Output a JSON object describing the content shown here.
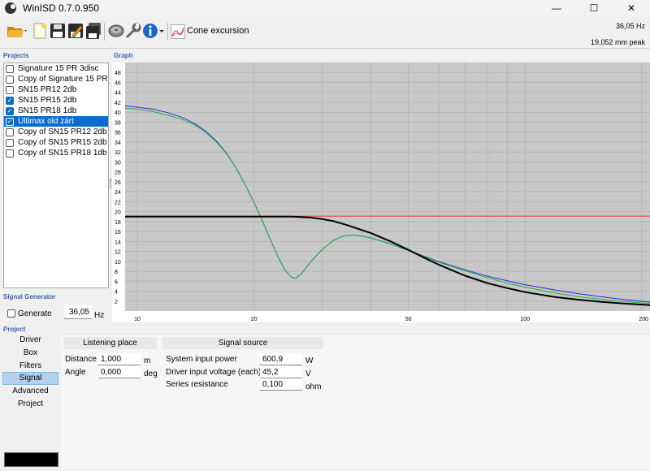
{
  "window": {
    "title": "WinISD 0.7.0.950",
    "minimize": "—",
    "maximize": "☐",
    "close": "✕"
  },
  "toolbar": {
    "icons": [
      "open-folder-icon",
      "new-document-icon",
      "save-icon",
      "save-as-icon",
      "save-all-icon",
      "speaker-icon",
      "wrench-icon",
      "info-icon",
      "cone-excursion-chart-icon"
    ],
    "view_label": "Cone excursion",
    "readout_frequency": "36,05 Hz",
    "readout_excursion": "19,052 mm peak"
  },
  "sections": {
    "projects": "Projects",
    "graph": "Graph",
    "signal_generator": "Signal Generator",
    "project": "Project"
  },
  "projects": [
    {
      "label": "Signature 15 PR 3disc",
      "checked": false,
      "selected": false
    },
    {
      "label": "Copy of Signature 15 PR 5d",
      "checked": false,
      "selected": false
    },
    {
      "label": "SN15 PR12 2db",
      "checked": false,
      "selected": false
    },
    {
      "label": "SN15 PR15 2db",
      "checked": true,
      "selected": false
    },
    {
      "label": "SN15 PR18 1db",
      "checked": true,
      "selected": false
    },
    {
      "label": "Ultimax old zárt",
      "checked": true,
      "selected": true
    },
    {
      "label": "Copy of SN15 PR12 2db",
      "checked": false,
      "selected": false
    },
    {
      "label": "Copy of SN15 PR15 2db",
      "checked": false,
      "selected": false
    },
    {
      "label": "Copy of SN15 PR18 1db",
      "checked": false,
      "selected": false
    }
  ],
  "signal_generator": {
    "generate_label": "Generate",
    "frequency_value": "36,05",
    "unit": "Hz"
  },
  "project_nav": {
    "items": [
      "Driver",
      "Box",
      "Filters",
      "Signal",
      "Advanced",
      "Project"
    ],
    "active": "Signal"
  },
  "listening_place": {
    "header": "Listening place",
    "distance_label": "Distance",
    "distance_value": "1,000",
    "distance_unit": "m",
    "angle_label": "Angle",
    "angle_value": "0,000",
    "angle_unit": "deg"
  },
  "signal_source": {
    "header": "Signal source",
    "power_label": "System input power",
    "power_value": "600,9",
    "power_unit": "W",
    "voltage_label": "Driver input voltage (each)",
    "voltage_value": "45,2",
    "voltage_unit": "V",
    "resistance_label": "Series resistance",
    "resistance_value": "0,100",
    "resistance_unit": "ohm"
  },
  "colors": {
    "selection": "#0a6ccf",
    "series_black": "#000000",
    "series_red": "#e03030",
    "series_blue": "#2b2bdc",
    "series_green": "#20b040",
    "plot_bg": "#c8c8c8"
  },
  "chart_data": {
    "type": "line",
    "x_scale": "log",
    "xlim": [
      9.3,
      210
    ],
    "ylim": [
      0,
      50
    ],
    "x_ticks": [
      {
        "v": 10,
        "label": "10"
      },
      {
        "v": 20,
        "label": "20"
      },
      {
        "v": 50,
        "label": "50"
      },
      {
        "v": 100,
        "label": "100"
      },
      {
        "v": 200,
        "label": "200"
      }
    ],
    "y_ticks": [
      2,
      4,
      6,
      8,
      10,
      12,
      14,
      16,
      18,
      20,
      22,
      24,
      26,
      28,
      30,
      32,
      34,
      36,
      38,
      40,
      42,
      44,
      46,
      48
    ],
    "grid": true,
    "series": [
      {
        "color": "#2b2bdc",
        "width": 1,
        "points": [
          [
            9.3,
            41.3
          ],
          [
            10,
            41
          ],
          [
            11,
            40.6
          ],
          [
            12,
            39.9
          ],
          [
            13,
            39
          ],
          [
            14,
            37.8
          ],
          [
            15,
            36.2
          ],
          [
            16,
            34.2
          ],
          [
            17,
            31.7
          ],
          [
            18,
            28.7
          ],
          [
            19,
            25.3
          ],
          [
            20,
            21.8
          ],
          [
            21,
            18.2
          ],
          [
            22,
            14.5
          ],
          [
            23,
            11.1
          ],
          [
            24,
            8.3
          ],
          [
            25,
            6.8
          ],
          [
            25.6,
            6.6
          ],
          [
            26.5,
            7.5
          ],
          [
            28,
            9.9
          ],
          [
            30,
            12.4
          ],
          [
            32,
            14.2
          ],
          [
            34,
            15.1
          ],
          [
            36,
            15.3
          ],
          [
            38,
            15.1
          ],
          [
            40,
            14.7
          ],
          [
            45,
            13.5
          ],
          [
            50,
            12.2
          ],
          [
            55,
            11
          ],
          [
            60,
            9.9
          ],
          [
            70,
            8.3
          ],
          [
            80,
            7
          ],
          [
            90,
            6.1
          ],
          [
            100,
            5.3
          ],
          [
            120,
            4.2
          ],
          [
            140,
            3.4
          ],
          [
            160,
            2.8
          ],
          [
            180,
            2.3
          ],
          [
            210,
            1.8
          ]
        ]
      },
      {
        "color": "#20b040",
        "width": 1,
        "points": [
          [
            9.3,
            40.8
          ],
          [
            10,
            40.6
          ],
          [
            11,
            40.1
          ],
          [
            12,
            39.4
          ],
          [
            13,
            38.6
          ],
          [
            14,
            37.5
          ],
          [
            15,
            36
          ],
          [
            16,
            34
          ],
          [
            17,
            31.6
          ],
          [
            18,
            28.7
          ],
          [
            19,
            25.3
          ],
          [
            20,
            21.8
          ],
          [
            21,
            18.2
          ],
          [
            22,
            14.5
          ],
          [
            23,
            11.1
          ],
          [
            24,
            8.3
          ],
          [
            25,
            6.8
          ],
          [
            25.6,
            6.6
          ],
          [
            26.5,
            7.5
          ],
          [
            28,
            9.9
          ],
          [
            30,
            12.4
          ],
          [
            32,
            14.2
          ],
          [
            34,
            15.1
          ],
          [
            36,
            15.3
          ],
          [
            38,
            15.1
          ],
          [
            40,
            14.7
          ],
          [
            45,
            13.5
          ],
          [
            50,
            12.2
          ],
          [
            55,
            10.9
          ],
          [
            60,
            9.8
          ],
          [
            70,
            8.1
          ],
          [
            80,
            6.7
          ],
          [
            90,
            5.6
          ],
          [
            100,
            4.8
          ],
          [
            120,
            3.6
          ],
          [
            140,
            2.8
          ],
          [
            160,
            2.3
          ],
          [
            180,
            1.9
          ],
          [
            210,
            1.5
          ]
        ]
      },
      {
        "color": "#e03030",
        "width": 1,
        "points": [
          [
            9.3,
            19.1
          ],
          [
            210,
            19.1
          ]
        ]
      },
      {
        "color": "#000000",
        "width": 2,
        "points": [
          [
            9.3,
            19
          ],
          [
            15,
            19
          ],
          [
            20,
            19
          ],
          [
            25,
            19
          ],
          [
            28,
            18.8
          ],
          [
            30,
            18.5
          ],
          [
            32,
            18.1
          ],
          [
            35,
            17.2
          ],
          [
            40,
            15.7
          ],
          [
            45,
            14
          ],
          [
            50,
            12.3
          ],
          [
            55,
            10.7
          ],
          [
            60,
            9.3
          ],
          [
            70,
            7.1
          ],
          [
            80,
            5.6
          ],
          [
            90,
            4.6
          ],
          [
            100,
            3.8
          ],
          [
            120,
            2.8
          ],
          [
            140,
            2.2
          ],
          [
            160,
            1.8
          ],
          [
            180,
            1.5
          ],
          [
            210,
            1.2
          ]
        ]
      }
    ]
  }
}
